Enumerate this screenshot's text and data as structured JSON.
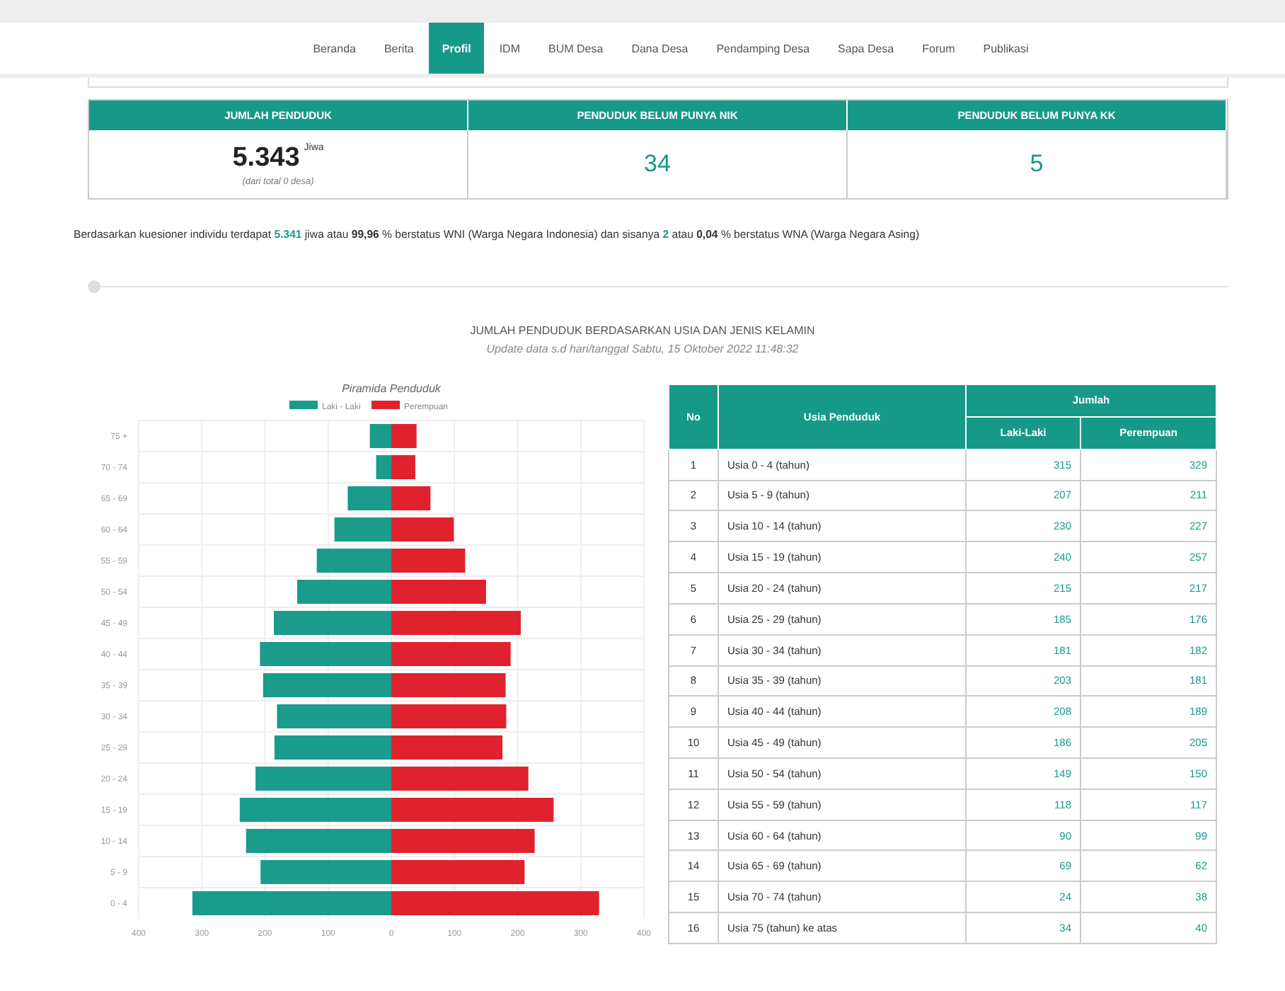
{
  "nav": {
    "tabs": [
      {
        "label": "Beranda",
        "selected": false
      },
      {
        "label": "Berita",
        "selected": false
      },
      {
        "label": "Profil",
        "selected": true
      },
      {
        "label": "IDM",
        "selected": false
      },
      {
        "label": "BUM Desa",
        "selected": false
      },
      {
        "label": "Dana Desa",
        "selected": false
      },
      {
        "label": "Pendamping Desa",
        "selected": false
      },
      {
        "label": "Sapa Desa",
        "selected": false
      },
      {
        "label": "Forum",
        "selected": false
      },
      {
        "label": "Publikasi",
        "selected": false
      }
    ]
  },
  "stats": [
    {
      "header": "JUMLAH PENDUDUK",
      "kind": "total",
      "value": "5.343",
      "unit": "Jiwa",
      "note": "(dari total 0 desa)"
    },
    {
      "header": "PENDUDUK BELUM PUNYA NIK",
      "kind": "count",
      "value": "34"
    },
    {
      "header": "PENDUDUK BELUM PUNYA KK",
      "kind": "count",
      "value": "5"
    }
  ],
  "summary": [
    {
      "text": "Berdasarkan kuesioner individu terdapat ",
      "kind": "plain"
    },
    {
      "text": "5.341",
      "kind": "highlight"
    },
    {
      "text": " jiwa atau ",
      "kind": "plain"
    },
    {
      "text": "99,96",
      "kind": "bold"
    },
    {
      "text": " % berstatus WNI (Warga Negara Indonesia) dan sisanya ",
      "kind": "plain"
    },
    {
      "text": "2",
      "kind": "highlight"
    },
    {
      "text": " atau ",
      "kind": "plain"
    },
    {
      "text": "0,04",
      "kind": "bold"
    },
    {
      "text": " % berstatus WNA (Warga Negara Asing)",
      "kind": "plain"
    }
  ],
  "section": {
    "title": "JUMLAH PENDUDUK BERDASARKAN USIA DAN JENIS KELAMIN",
    "subtitle": "Update data s.d hari/tanggal Sabtu, 15 Oktober 2022 11:48:32"
  },
  "chart_data": {
    "type": "bar",
    "orientation": "horizontal",
    "stacked": true,
    "title": "Piramida Penduduk",
    "categories": [
      "75 +",
      "70 - 74",
      "65 - 69",
      "60 - 64",
      "55 - 59",
      "50 - 54",
      "45 - 49",
      "40 - 44",
      "35 - 39",
      "30 - 34",
      "25 - 29",
      "20 - 24",
      "15 - 19",
      "10 - 14",
      "5 - 9",
      "0 - 4"
    ],
    "series": [
      {
        "name": "Laki - Laki",
        "color": "#1a9b8c",
        "values": [
          -34,
          -24,
          -69,
          -90,
          -118,
          -149,
          -186,
          -208,
          -203,
          -181,
          -185,
          -215,
          -240,
          -230,
          -207,
          -315
        ]
      },
      {
        "name": "Perempuan",
        "color": "#e0222e",
        "values": [
          40,
          38,
          62,
          99,
          117,
          150,
          205,
          189,
          181,
          182,
          176,
          217,
          257,
          227,
          211,
          329
        ]
      }
    ],
    "xlim": [
      -400,
      400
    ],
    "grid": true,
    "legend": true,
    "xticks": [
      {
        "value": -400,
        "label": "400"
      },
      {
        "value": -300,
        "label": "300"
      },
      {
        "value": -200,
        "label": "200"
      },
      {
        "value": -100,
        "label": "100"
      },
      0,
      100,
      200,
      300,
      400
    ]
  },
  "table": {
    "columns": {
      "no": "No",
      "age": "Usia Penduduk",
      "group": "Jumlah",
      "male": "Laki-Laki",
      "female": "Perempuan"
    },
    "rows": [
      {
        "no": "1",
        "age": "Usia 0 - 4 (tahun)",
        "male": "315",
        "female": "329"
      },
      {
        "no": "2",
        "age": "Usia 5 - 9 (tahun)",
        "male": "207",
        "female": "211"
      },
      {
        "no": "3",
        "age": "Usia 10 - 14 (tahun)",
        "male": "230",
        "female": "227"
      },
      {
        "no": "4",
        "age": "Usia 15 - 19 (tahun)",
        "male": "240",
        "female": "257"
      },
      {
        "no": "5",
        "age": "Usia 20 - 24 (tahun)",
        "male": "215",
        "female": "217"
      },
      {
        "no": "6",
        "age": "Usia 25 - 29 (tahun)",
        "male": "185",
        "female": "176"
      },
      {
        "no": "7",
        "age": "Usia 30 - 34 (tahun)",
        "male": "181",
        "female": "182"
      },
      {
        "no": "8",
        "age": "Usia 35 - 39 (tahun)",
        "male": "203",
        "female": "181"
      },
      {
        "no": "9",
        "age": "Usia 40 - 44 (tahun)",
        "male": "208",
        "female": "189"
      },
      {
        "no": "10",
        "age": "Usia 45 - 49 (tahun)",
        "male": "186",
        "female": "205"
      },
      {
        "no": "11",
        "age": "Usia 50 - 54 (tahun)",
        "male": "149",
        "female": "150"
      },
      {
        "no": "12",
        "age": "Usia 55 - 59 (tahun)",
        "male": "118",
        "female": "117"
      },
      {
        "no": "13",
        "age": "Usia 60 - 64 (tahun)",
        "male": "90",
        "female": "99"
      },
      {
        "no": "14",
        "age": "Usia 65 - 69 (tahun)",
        "male": "69",
        "female": "62"
      },
      {
        "no": "15",
        "age": "Usia 70 - 74 (tahun)",
        "male": "24",
        "female": "38"
      },
      {
        "no": "16",
        "age": "Usia 75 (tahun) ke atas",
        "male": "34",
        "female": "40"
      }
    ]
  }
}
